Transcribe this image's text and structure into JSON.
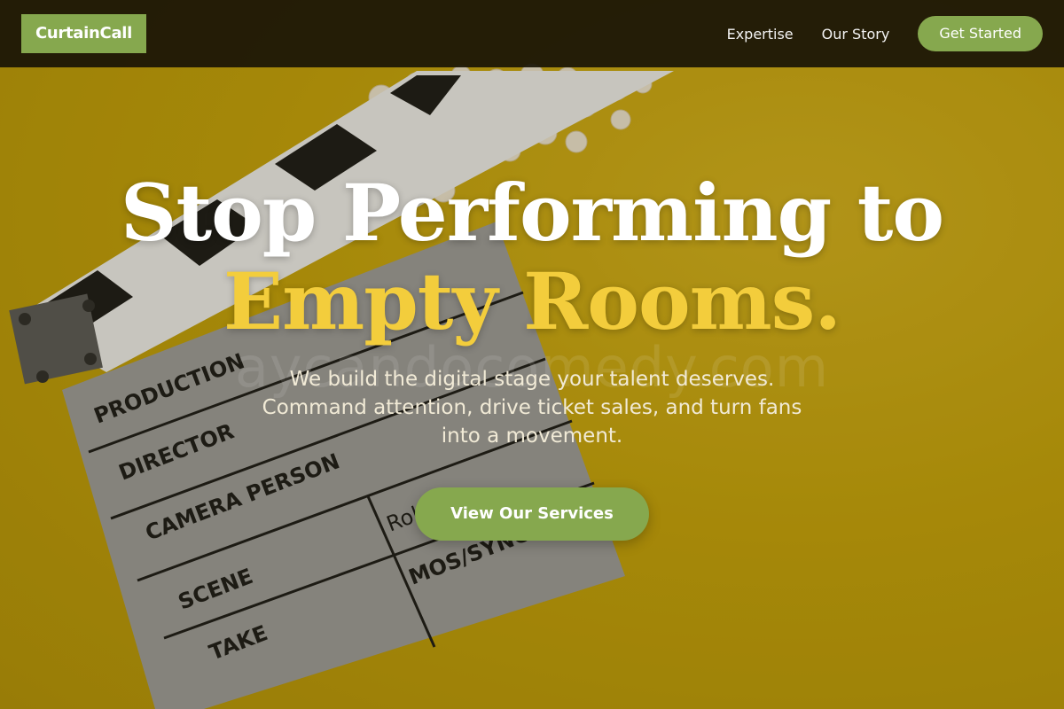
{
  "nav": {
    "logo": "CurtainCall",
    "links": [
      {
        "label": "Expertise"
      },
      {
        "label": "Our Story"
      }
    ],
    "cta_label": "Get Started"
  },
  "hero": {
    "headline_line1": "Stop Performing to",
    "headline_line2": "Empty Rooms.",
    "subtext": "We build the digital stage your talent deserves. Command attention, drive ticket sales, and turn fans into a movement.",
    "cta_label": "View Our Services",
    "watermark": "aycandocomedy.com",
    "clapperboard": {
      "labels": [
        "PRODUCTION",
        "DIRECTOR",
        "CAMERA PERSON",
        "SCENE",
        "TAKE",
        "Roll",
        "MOS/SYNC"
      ]
    }
  },
  "colors": {
    "accent_green": "#86a84e",
    "headline_yellow": "#f3cd3c",
    "background_yellow": "#c9a70c",
    "nav_background": "#1a1406"
  }
}
